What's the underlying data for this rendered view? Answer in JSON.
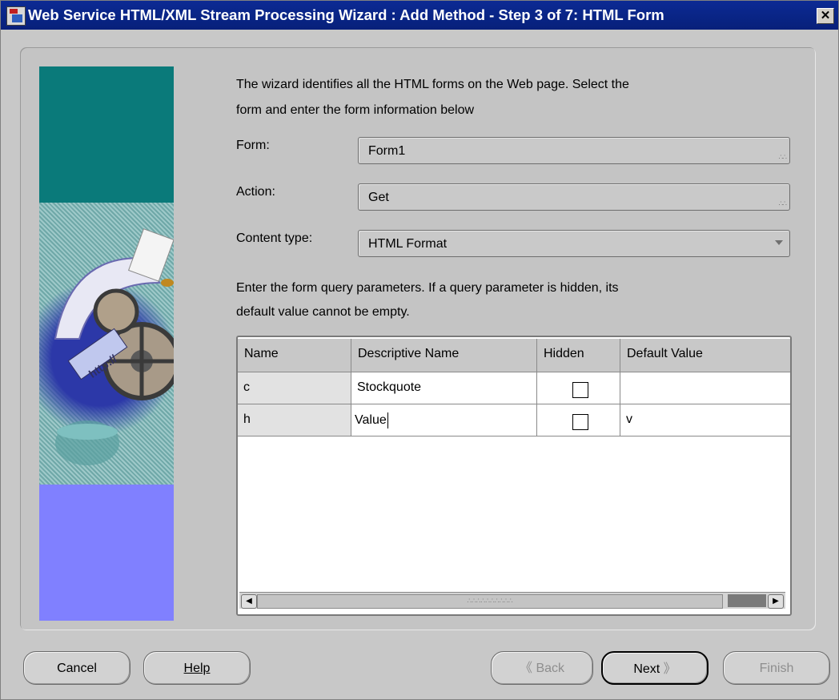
{
  "window": {
    "title": "Web Service HTML/XML Stream Processing Wizard : Add Method - Step 3 of 7: HTML Form",
    "close_glyph": "✕"
  },
  "intro_text_line1": "The wizard identifies all the HTML forms on the Web page. Select the",
  "intro_text_line2": "form and enter the form information below",
  "form_field": {
    "label": "Form:",
    "value": "Form1"
  },
  "action_field": {
    "label": "Action:",
    "value": "Get"
  },
  "content_type_field": {
    "label": "Content type:",
    "value": "HTML Format"
  },
  "params_text_line1": "Enter the form query parameters. If a query parameter is hidden, its",
  "params_text_line2": "default value cannot be empty.",
  "side_image_text": "http://",
  "table": {
    "headers": [
      "Name",
      "Descriptive Name",
      "Hidden",
      "Default Value"
    ],
    "rows": [
      {
        "name": "c",
        "descriptive_name": "Stockquote",
        "hidden": false,
        "default_value": ""
      },
      {
        "name": "h",
        "descriptive_name": "Value",
        "hidden": false,
        "default_value": "v"
      }
    ]
  },
  "buttons": {
    "cancel": "Cancel",
    "help": "Help",
    "back": "Back",
    "next": "Next",
    "finish": "Finish",
    "back_glyph": "《",
    "next_glyph": "》"
  },
  "icons": [
    "app-icon",
    "close-icon",
    "dropdown-arrow-icon",
    "checkbox-icon",
    "scroll-left-icon",
    "scroll-right-icon",
    "back-arrow-icon",
    "next-arrow-icon",
    "wizard-illustration"
  ],
  "colors": {
    "titlebar": "#0c2a94",
    "side_teal": "#0a7a7a",
    "side_purple": "#8080ff"
  }
}
